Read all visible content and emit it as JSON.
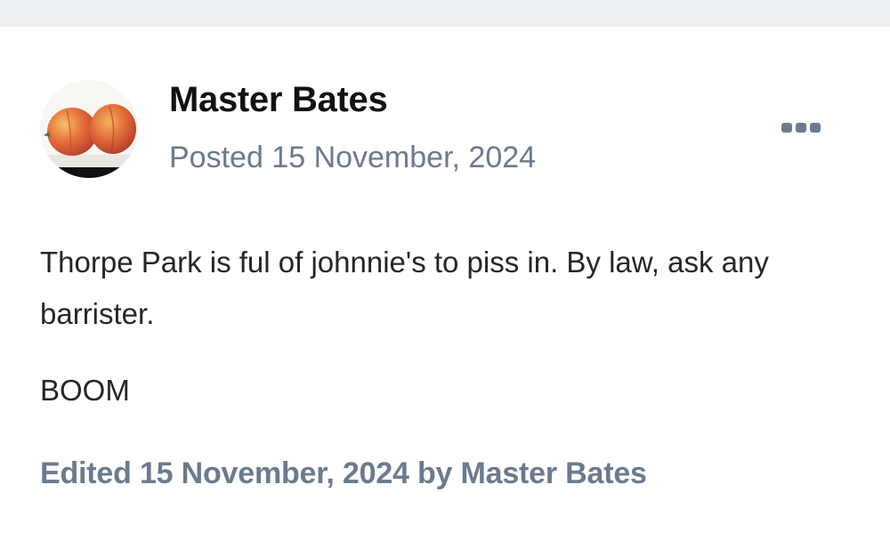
{
  "post": {
    "author": "Master Bates",
    "posted_date": "Posted 15 November, 2024",
    "body": [
      "Thorpe Park is ful of johnnie's to piss in. By law, ask any barrister.",
      "BOOM"
    ],
    "edited_note": "Edited 15 November, 2024 by Master Bates",
    "avatar_icon": "peaches-avatar",
    "menu_icon": "more-options-icon"
  },
  "colors": {
    "meta_text": "#6b7a8e",
    "body_text": "#262626",
    "header_strip": "#ebeef3"
  }
}
